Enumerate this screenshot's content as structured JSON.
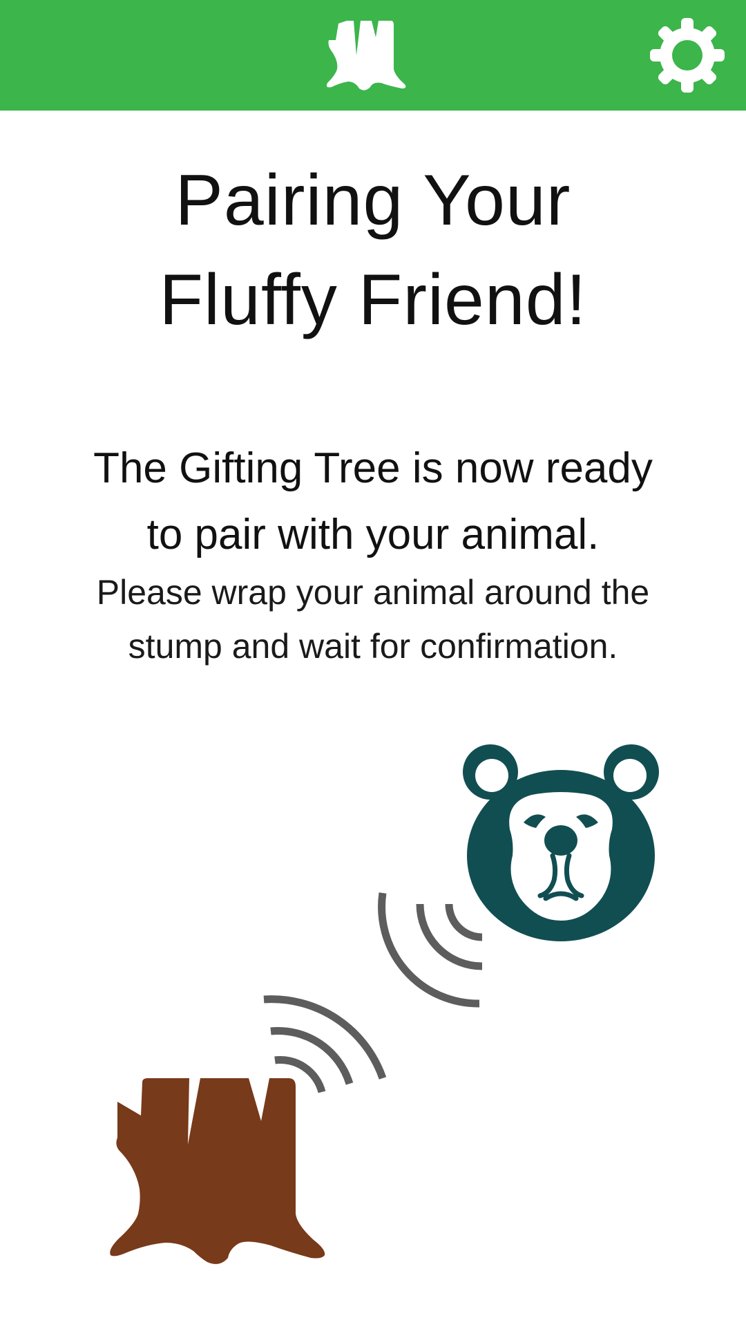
{
  "header": {
    "logo_icon": "tree-stump-icon",
    "settings_icon": "gear-icon",
    "bar_color": "#3cb54b"
  },
  "title": {
    "line1": "Pairing Your",
    "line2": "Fluffy Friend!"
  },
  "message": {
    "lead_line1": "The Gifting Tree is now ready",
    "lead_line2": "to pair with your animal.",
    "sub_line1": "Please wrap your animal around the",
    "sub_line2": "stump and wait for confirmation."
  },
  "illustration": {
    "animal_icon": "bear-face-icon",
    "stump_icon": "tree-stump-icon",
    "signal_icon": "wireless-signal-icon",
    "bear_color": "#114e52",
    "stump_color": "#773a1a",
    "signal_color": "#5d5d5d"
  }
}
